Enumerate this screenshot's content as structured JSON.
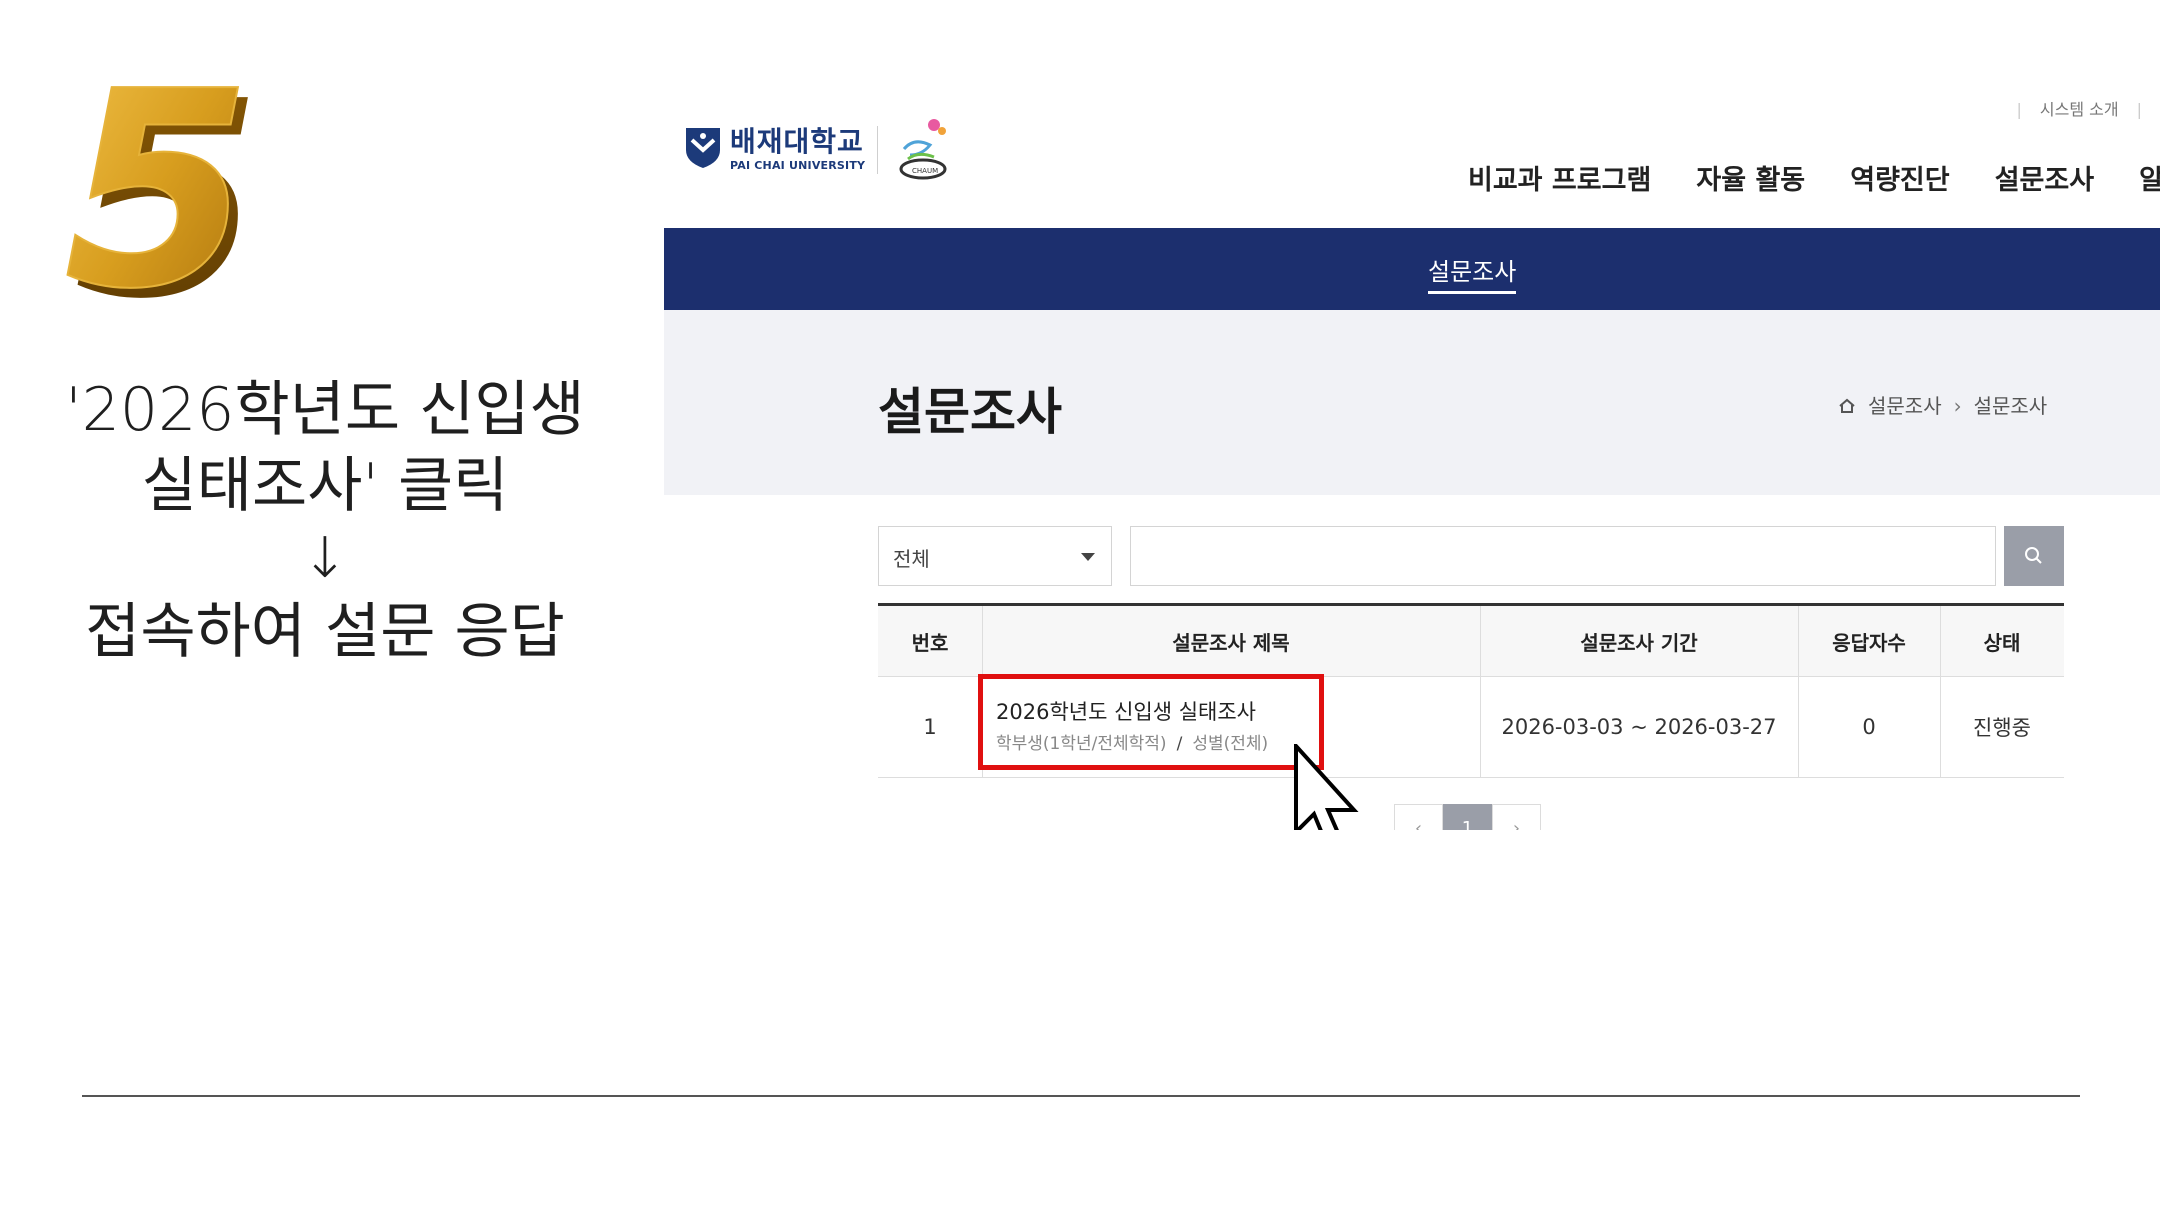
{
  "slide": {
    "step_number": "5",
    "instruction_line1": "'2026학년도 신입생",
    "instruction_line2": "실태조사' 클릭",
    "instruction_arrow": "↓",
    "instruction_line3": "접속하여 설문 응답"
  },
  "site": {
    "logo": {
      "name_ko": "배재대학교",
      "name_en": "PAI CHAI UNIVERSITY",
      "chaum_text": "CHAUM"
    },
    "utility": {
      "system_intro": "시스템 소개"
    },
    "gnb": [
      "비교과 프로그램",
      "자율 활동",
      "역량진단",
      "설문조사",
      "알림"
    ],
    "subnav_active": "설문조사",
    "page_title": "설문조사",
    "breadcrumb": {
      "level1": "설문조사",
      "sep": "›",
      "level2": "설문조사"
    },
    "filter": {
      "selected": "전체"
    },
    "search": {
      "placeholder": ""
    },
    "table": {
      "headers": [
        "번호",
        "설문조사 제목",
        "설문조사 기간",
        "응답자수",
        "상태"
      ],
      "rows": [
        {
          "no": "1",
          "title": "2026학년도 신입생 실태조사",
          "target_a": "학부생(1학년/전체학적)",
          "target_sep": "/",
          "target_b": "성별(전체)",
          "period": "2026-03-03 ~ 2026-03-27",
          "respondents": "0",
          "status": "진행중"
        }
      ]
    },
    "pagination": {
      "prev": "‹",
      "current": "1",
      "next": "›"
    }
  },
  "colors": {
    "navy": "#1c2f6e",
    "highlight_red": "#e01010",
    "gold": "#c9961a"
  }
}
